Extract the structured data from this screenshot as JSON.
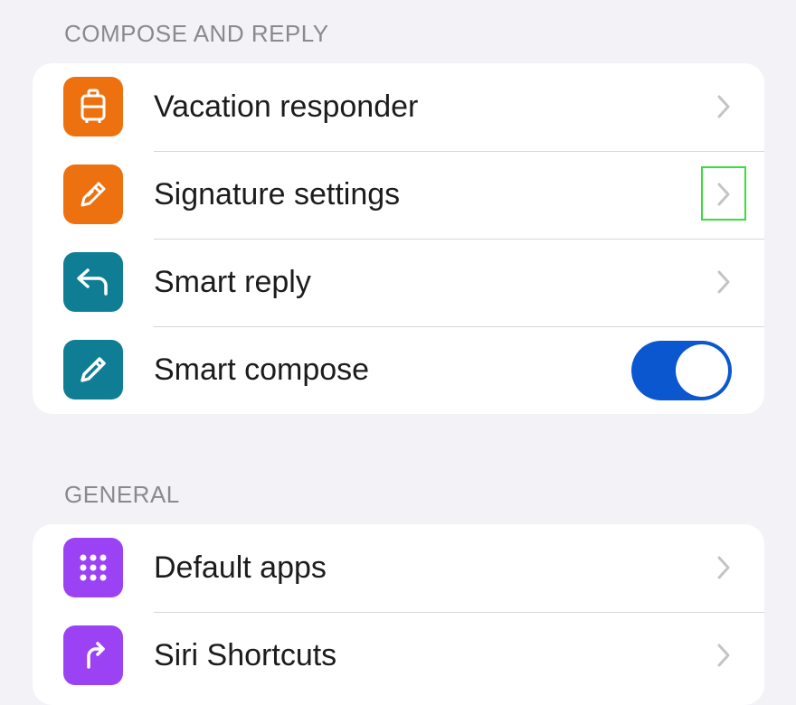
{
  "sections": [
    {
      "header": "COMPOSE AND REPLY",
      "items": [
        {
          "label": "Vacation responder",
          "icon": "suitcase-icon",
          "icon_bg": "#ee7110",
          "control": "chevron"
        },
        {
          "label": "Signature settings",
          "icon": "signature-pen-icon",
          "icon_bg": "#ee7110",
          "control": "chevron",
          "focused": true
        },
        {
          "label": "Smart reply",
          "icon": "reply-arrow-icon",
          "icon_bg": "#0f7e95",
          "control": "chevron"
        },
        {
          "label": "Smart compose",
          "icon": "pencil-icon",
          "icon_bg": "#0f7e95",
          "control": "toggle",
          "toggle_on": true
        }
      ]
    },
    {
      "header": "GENERAL",
      "items": [
        {
          "label": "Default apps",
          "icon": "app-grid-icon",
          "icon_bg": "#9c42f5",
          "control": "chevron"
        },
        {
          "label": "Siri Shortcuts",
          "icon": "shortcut-icon",
          "icon_bg": "#9c42f5",
          "control": "chevron"
        }
      ]
    }
  ],
  "colors": {
    "background": "#f2f2f7",
    "toggle_on": "#0b57d0",
    "focus_outline": "#3bdc3b",
    "chevron": "#c4c4c7"
  }
}
